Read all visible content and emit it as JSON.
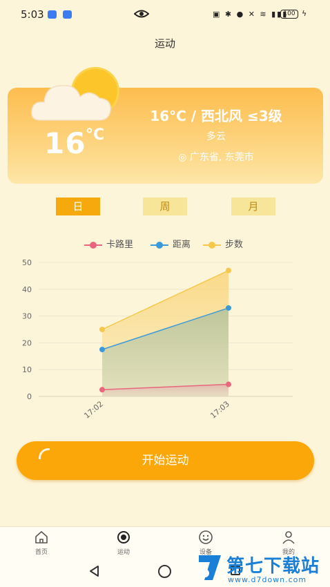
{
  "status_bar": {
    "time": "5:03",
    "battery": "100"
  },
  "page": {
    "title": "运动"
  },
  "weather": {
    "temp": "16",
    "unit": "°C",
    "summary": "16°C / 西北风 ≤3级",
    "condition": "多云",
    "location": "◎ 广东省, 东莞市",
    "icon": "cloud-sun-icon"
  },
  "tabs": [
    {
      "label": "日",
      "active": true
    },
    {
      "label": "周",
      "active": false
    },
    {
      "label": "月",
      "active": false
    }
  ],
  "chart_data": {
    "type": "area",
    "x": [
      "17:02",
      "17:03"
    ],
    "ylim": [
      0,
      50
    ],
    "yticks": [
      "0",
      "10",
      "20",
      "30",
      "40",
      "50"
    ],
    "series": [
      {
        "name": "卡路里",
        "color": "#e8667e",
        "values": [
          2.5,
          4.5
        ]
      },
      {
        "name": "距离",
        "color": "#3a9ad9",
        "values": [
          17.5,
          33
        ]
      },
      {
        "name": "步数",
        "color": "#f5c84b",
        "values": [
          25,
          47
        ]
      }
    ],
    "legend_position": "top-center",
    "grid": true
  },
  "actions": {
    "start_label": "开始运动"
  },
  "bottom_nav": [
    {
      "label": "首页",
      "icon": "home-icon"
    },
    {
      "label": "运动",
      "icon": "eye-icon"
    },
    {
      "label": "设备",
      "icon": "smile-icon"
    },
    {
      "label": "我的",
      "icon": "user-icon"
    }
  ],
  "watermark": {
    "name": "第七下载站",
    "url": "www.d7down.com"
  }
}
